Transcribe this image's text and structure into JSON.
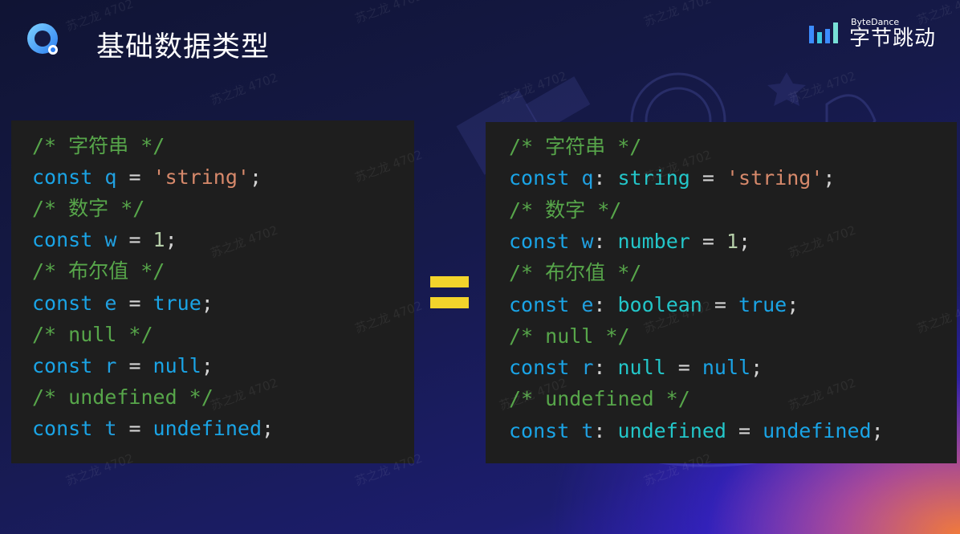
{
  "header": {
    "title": "基础数据类型",
    "brand_en": "ByteDance",
    "brand_zh": "字节跳动"
  },
  "watermark": "苏之龙 4702",
  "left_code": [
    [
      {
        "t": "cm",
        "v": "/* 字符串 */"
      }
    ],
    [
      {
        "t": "kw",
        "v": "const"
      },
      {
        "t": "op",
        "v": " "
      },
      {
        "t": "var",
        "v": "q"
      },
      {
        "t": "op",
        "v": " = "
      },
      {
        "t": "str",
        "v": "'string'"
      },
      {
        "t": "punc",
        "v": ";"
      }
    ],
    [
      {
        "t": "cm",
        "v": "/* 数字 */"
      }
    ],
    [
      {
        "t": "kw",
        "v": "const"
      },
      {
        "t": "op",
        "v": " "
      },
      {
        "t": "var",
        "v": "w"
      },
      {
        "t": "op",
        "v": " = "
      },
      {
        "t": "num",
        "v": "1"
      },
      {
        "t": "punc",
        "v": ";"
      }
    ],
    [
      {
        "t": "cm",
        "v": "/* 布尔值 */"
      }
    ],
    [
      {
        "t": "kw",
        "v": "const"
      },
      {
        "t": "op",
        "v": " "
      },
      {
        "t": "var",
        "v": "e"
      },
      {
        "t": "op",
        "v": " = "
      },
      {
        "t": "bool",
        "v": "true"
      },
      {
        "t": "punc",
        "v": ";"
      }
    ],
    [
      {
        "t": "cm",
        "v": "/* null */"
      }
    ],
    [
      {
        "t": "kw",
        "v": "const"
      },
      {
        "t": "op",
        "v": " "
      },
      {
        "t": "var",
        "v": "r"
      },
      {
        "t": "op",
        "v": " = "
      },
      {
        "t": "bool",
        "v": "null"
      },
      {
        "t": "punc",
        "v": ";"
      }
    ],
    [
      {
        "t": "cm",
        "v": "/* undefined */"
      }
    ],
    [
      {
        "t": "kw",
        "v": "const"
      },
      {
        "t": "op",
        "v": " "
      },
      {
        "t": "var",
        "v": "t"
      },
      {
        "t": "op",
        "v": " = "
      },
      {
        "t": "bool",
        "v": "undefined"
      },
      {
        "t": "punc",
        "v": ";"
      }
    ]
  ],
  "right_code": [
    [
      {
        "t": "cm",
        "v": "/* 字符串 */"
      }
    ],
    [
      {
        "t": "kw",
        "v": "const"
      },
      {
        "t": "op",
        "v": " "
      },
      {
        "t": "var",
        "v": "q"
      },
      {
        "t": "punc",
        "v": ": "
      },
      {
        "t": "type",
        "v": "string"
      },
      {
        "t": "op",
        "v": " = "
      },
      {
        "t": "str",
        "v": "'string'"
      },
      {
        "t": "punc",
        "v": ";"
      }
    ],
    [
      {
        "t": "cm",
        "v": "/* 数字 */"
      }
    ],
    [
      {
        "t": "kw",
        "v": "const"
      },
      {
        "t": "op",
        "v": " "
      },
      {
        "t": "var",
        "v": "w"
      },
      {
        "t": "punc",
        "v": ": "
      },
      {
        "t": "type",
        "v": "number"
      },
      {
        "t": "op",
        "v": " = "
      },
      {
        "t": "num",
        "v": "1"
      },
      {
        "t": "punc",
        "v": ";"
      }
    ],
    [
      {
        "t": "cm",
        "v": "/* 布尔值 */"
      }
    ],
    [
      {
        "t": "kw",
        "v": "const"
      },
      {
        "t": "op",
        "v": " "
      },
      {
        "t": "var",
        "v": "e"
      },
      {
        "t": "punc",
        "v": ": "
      },
      {
        "t": "type",
        "v": "boolean"
      },
      {
        "t": "op",
        "v": " = "
      },
      {
        "t": "bool",
        "v": "true"
      },
      {
        "t": "punc",
        "v": ";"
      }
    ],
    [
      {
        "t": "cm",
        "v": "/* null */"
      }
    ],
    [
      {
        "t": "kw",
        "v": "const"
      },
      {
        "t": "op",
        "v": " "
      },
      {
        "t": "var",
        "v": "r"
      },
      {
        "t": "punc",
        "v": ": "
      },
      {
        "t": "type",
        "v": "null"
      },
      {
        "t": "op",
        "v": " = "
      },
      {
        "t": "bool",
        "v": "null"
      },
      {
        "t": "punc",
        "v": ";"
      }
    ],
    [
      {
        "t": "cm",
        "v": "/* undefined */"
      }
    ],
    [
      {
        "t": "kw",
        "v": "const"
      },
      {
        "t": "op",
        "v": " "
      },
      {
        "t": "var",
        "v": "t"
      },
      {
        "t": "punc",
        "v": ": "
      },
      {
        "t": "type",
        "v": "undefined"
      },
      {
        "t": "op",
        "v": " = "
      },
      {
        "t": "bool",
        "v": "undefined"
      },
      {
        "t": "punc",
        "v": ";"
      }
    ]
  ],
  "colors": {
    "comment": "#57a64a",
    "keyword": "#1aa4e6",
    "string": "#d7896b",
    "type": "#23c6c9",
    "equals_sign": "#f3d42b"
  },
  "icons": {
    "app_logo": "q-logo-icon",
    "brand_logo": "bytedance-logo-icon",
    "equals": "equals-icon"
  }
}
